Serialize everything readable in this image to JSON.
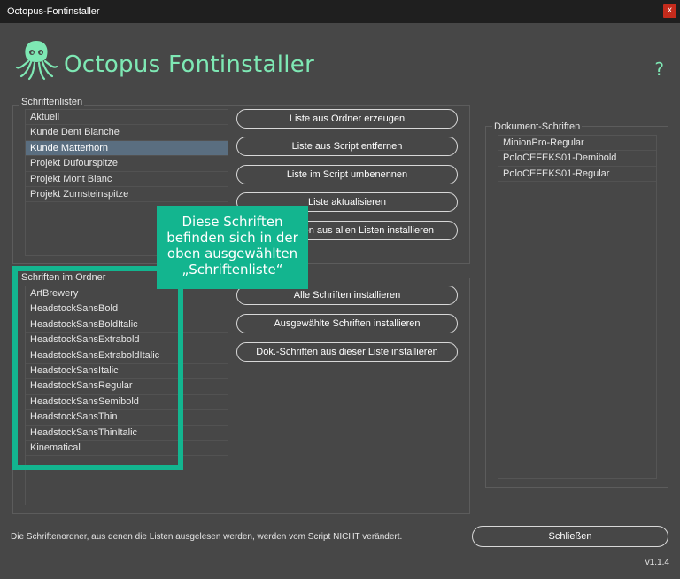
{
  "window": {
    "title": "Octopus-Fontinstaller",
    "close_label": "x"
  },
  "header": {
    "app_title": "Octopus Fontinstaller",
    "help_label": "?",
    "logo_icon": "octopus-logo-icon"
  },
  "colors": {
    "accent": "#7ee8b4",
    "highlight": "#13b58f",
    "selection": "#5a6e80",
    "background": "#474747"
  },
  "schriftenlisten": {
    "label": "Schriftenlisten",
    "items": [
      {
        "label": "Aktuell"
      },
      {
        "label": "Kunde Dent Blanche"
      },
      {
        "label": "Kunde Matterhorn",
        "selected": true
      },
      {
        "label": "Projekt Dufourspitze"
      },
      {
        "label": "Projekt Mont Blanc"
      },
      {
        "label": "Projekt Zumsteinspitze"
      }
    ],
    "buttons": [
      "Liste aus Ordner erzeugen",
      "Liste aus Script entfernen",
      "Liste im Script umbenennen",
      "Liste aktualisieren",
      "Schriften aus allen Listen installieren"
    ]
  },
  "ordner": {
    "label": "Schriften im Ordner",
    "items": [
      "ArtBrewery",
      "HeadstockSansBold",
      "HeadstockSansBoldItalic",
      "HeadstockSansExtrabold",
      "HeadstockSansExtraboldItalic",
      "HeadstockSansItalic",
      "HeadstockSansRegular",
      "HeadstockSansSemibold",
      "HeadstockSansThin",
      "HeadstockSansThinItalic",
      "Kinematical"
    ],
    "buttons": [
      "Alle Schriften installieren",
      "Ausgewählte Schriften installieren",
      "Dok.-Schriften aus dieser Liste installieren"
    ]
  },
  "dokument": {
    "label": "Dokument-Schriften",
    "items": [
      "MinionPro-Regular",
      "PoloCEFEKS01-Demibold",
      "PoloCEFEKS01-Regular"
    ]
  },
  "callout": {
    "lines": [
      "Diese Schriften",
      "befinden sich in der",
      "oben ausgewählten",
      "„Schriftenliste“"
    ]
  },
  "footer": {
    "note": "Die Schriftenordner, aus denen die Listen ausgelesen werden, werden vom Script NICHT verändert.",
    "close_button": "Schließen",
    "version": "v1.1.4"
  }
}
